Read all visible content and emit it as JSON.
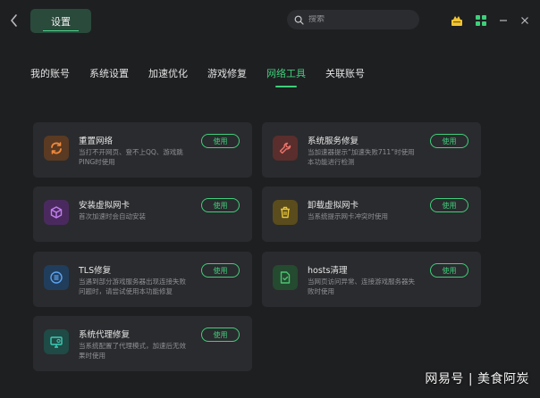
{
  "titlebar": {
    "tab_label": "设置",
    "search_placeholder": "搜索"
  },
  "nav": {
    "items": [
      {
        "label": "我的账号",
        "active": false
      },
      {
        "label": "系统设置",
        "active": false
      },
      {
        "label": "加速优化",
        "active": false
      },
      {
        "label": "游戏修复",
        "active": false
      },
      {
        "label": "网络工具",
        "active": true
      },
      {
        "label": "关联账号",
        "active": false
      }
    ]
  },
  "tools": [
    {
      "title": "重置网络",
      "desc": "当打不开网页、登不上QQ、游戏跳PING时使用",
      "button": "使用",
      "icon": "refresh-icon",
      "color": "#f08a3c"
    },
    {
      "title": "系统服务修复",
      "desc": "当加速器提示“加速失败711”时使用本功能进行检测",
      "button": "使用",
      "icon": "wrench-icon",
      "color": "#e8736b"
    },
    {
      "title": "安装虚拟网卡",
      "desc": "首次加速时会自动安装",
      "button": "使用",
      "icon": "cube-icon",
      "color": "#b26ae0"
    },
    {
      "title": "卸载虚拟网卡",
      "desc": "当系统提示网卡冲突时使用",
      "button": "使用",
      "icon": "trash-icon",
      "color": "#e6c53a"
    },
    {
      "title": "TLS修复",
      "desc": "当遇到部分游戏服务器出现连接失败问题时，请尝试使用本功能修复",
      "button": "使用",
      "icon": "list-circle-icon",
      "color": "#4a90e2"
    },
    {
      "title": "hosts清理",
      "desc": "当网页访问异常、连接游戏服务器失败时使用",
      "button": "使用",
      "icon": "file-check-icon",
      "color": "#4cc471"
    },
    {
      "title": "系统代理修复",
      "desc": "当系统配置了代理模式，加速后无效果时使用",
      "button": "使用",
      "icon": "monitor-icon",
      "color": "#3ccdb6"
    }
  ],
  "watermark": "网易号 | 美食阿炭"
}
